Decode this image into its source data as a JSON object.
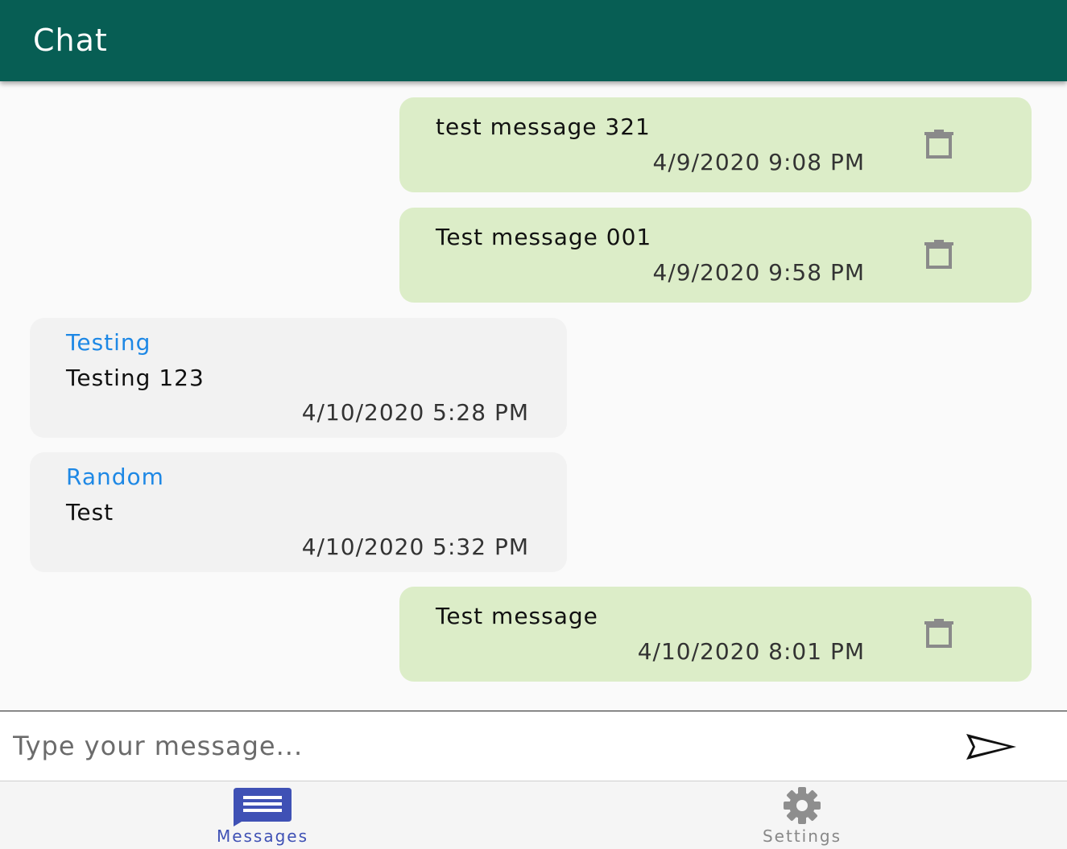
{
  "header": {
    "title": "Chat"
  },
  "messages": [
    {
      "direction": "outgoing",
      "text": "test message 321",
      "time": "4/9/2020 9:08 PM",
      "delete_icon": "trash-icon"
    },
    {
      "direction": "outgoing",
      "text": "Test message 001",
      "time": "4/9/2020 9:58 PM",
      "delete_icon": "trash-icon"
    },
    {
      "direction": "incoming",
      "sender": "Testing",
      "text": "Testing 123",
      "time": "4/10/2020 5:28 PM"
    },
    {
      "direction": "incoming",
      "sender": "Random",
      "text": "Test",
      "time": "4/10/2020 5:32 PM"
    },
    {
      "direction": "outgoing",
      "text": "Test message",
      "time": "4/10/2020 8:01 PM",
      "delete_icon": "trash-icon"
    }
  ],
  "composer": {
    "placeholder": "Type your message...",
    "value": "",
    "send_icon": "send-icon"
  },
  "bottom_nav": {
    "items": [
      {
        "label": "Messages",
        "icon": "message-icon",
        "active": true
      },
      {
        "label": "Settings",
        "icon": "gear-icon",
        "active": false
      }
    ]
  },
  "colors": {
    "header": "#075e54",
    "outgoing_bubble": "#dcedc8",
    "incoming_bubble": "#f2f2f2",
    "sender_name": "#1e88e5",
    "active_nav": "#3f51b5",
    "inactive_nav": "#888888"
  }
}
